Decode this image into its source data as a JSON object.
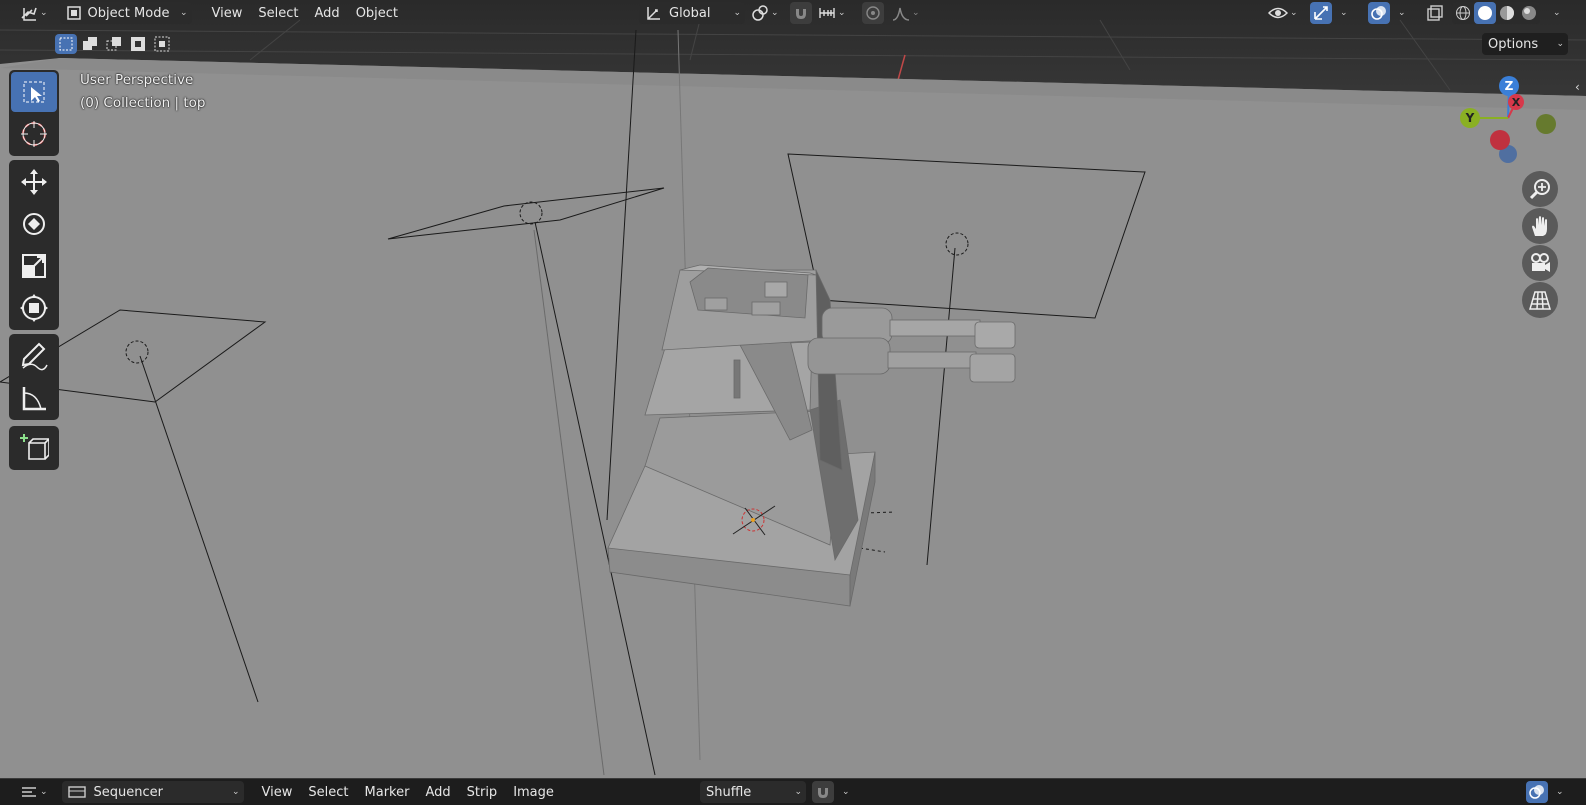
{
  "header": {
    "mode": "Object Mode",
    "menus": [
      "View",
      "Select",
      "Add",
      "Object"
    ],
    "orientation": "Global",
    "options": "Options"
  },
  "viewport": {
    "perspective": "User Perspective",
    "collection": "(0) Collection | top"
  },
  "gizmo": {
    "z": "Z",
    "x": "X",
    "y": "Y"
  },
  "toolbar_icons": [
    "select-box-icon",
    "cursor-icon",
    "move-icon",
    "rotate-icon",
    "scale-icon",
    "transform-icon",
    "annotate-icon",
    "measure-icon",
    "add-cube-icon"
  ],
  "sequencer": {
    "editor": "Sequencer",
    "menus": [
      "View",
      "Select",
      "Marker",
      "Add",
      "Strip",
      "Image"
    ],
    "playback": "Shuffle"
  },
  "colors": {
    "header_bg": "#303030",
    "active_blue": "#4772b3",
    "viewport_floor": "#8f8f8f",
    "axis_x": "#d7384a",
    "axis_y": "#8ab023",
    "axis_z": "#3a7fd8"
  }
}
